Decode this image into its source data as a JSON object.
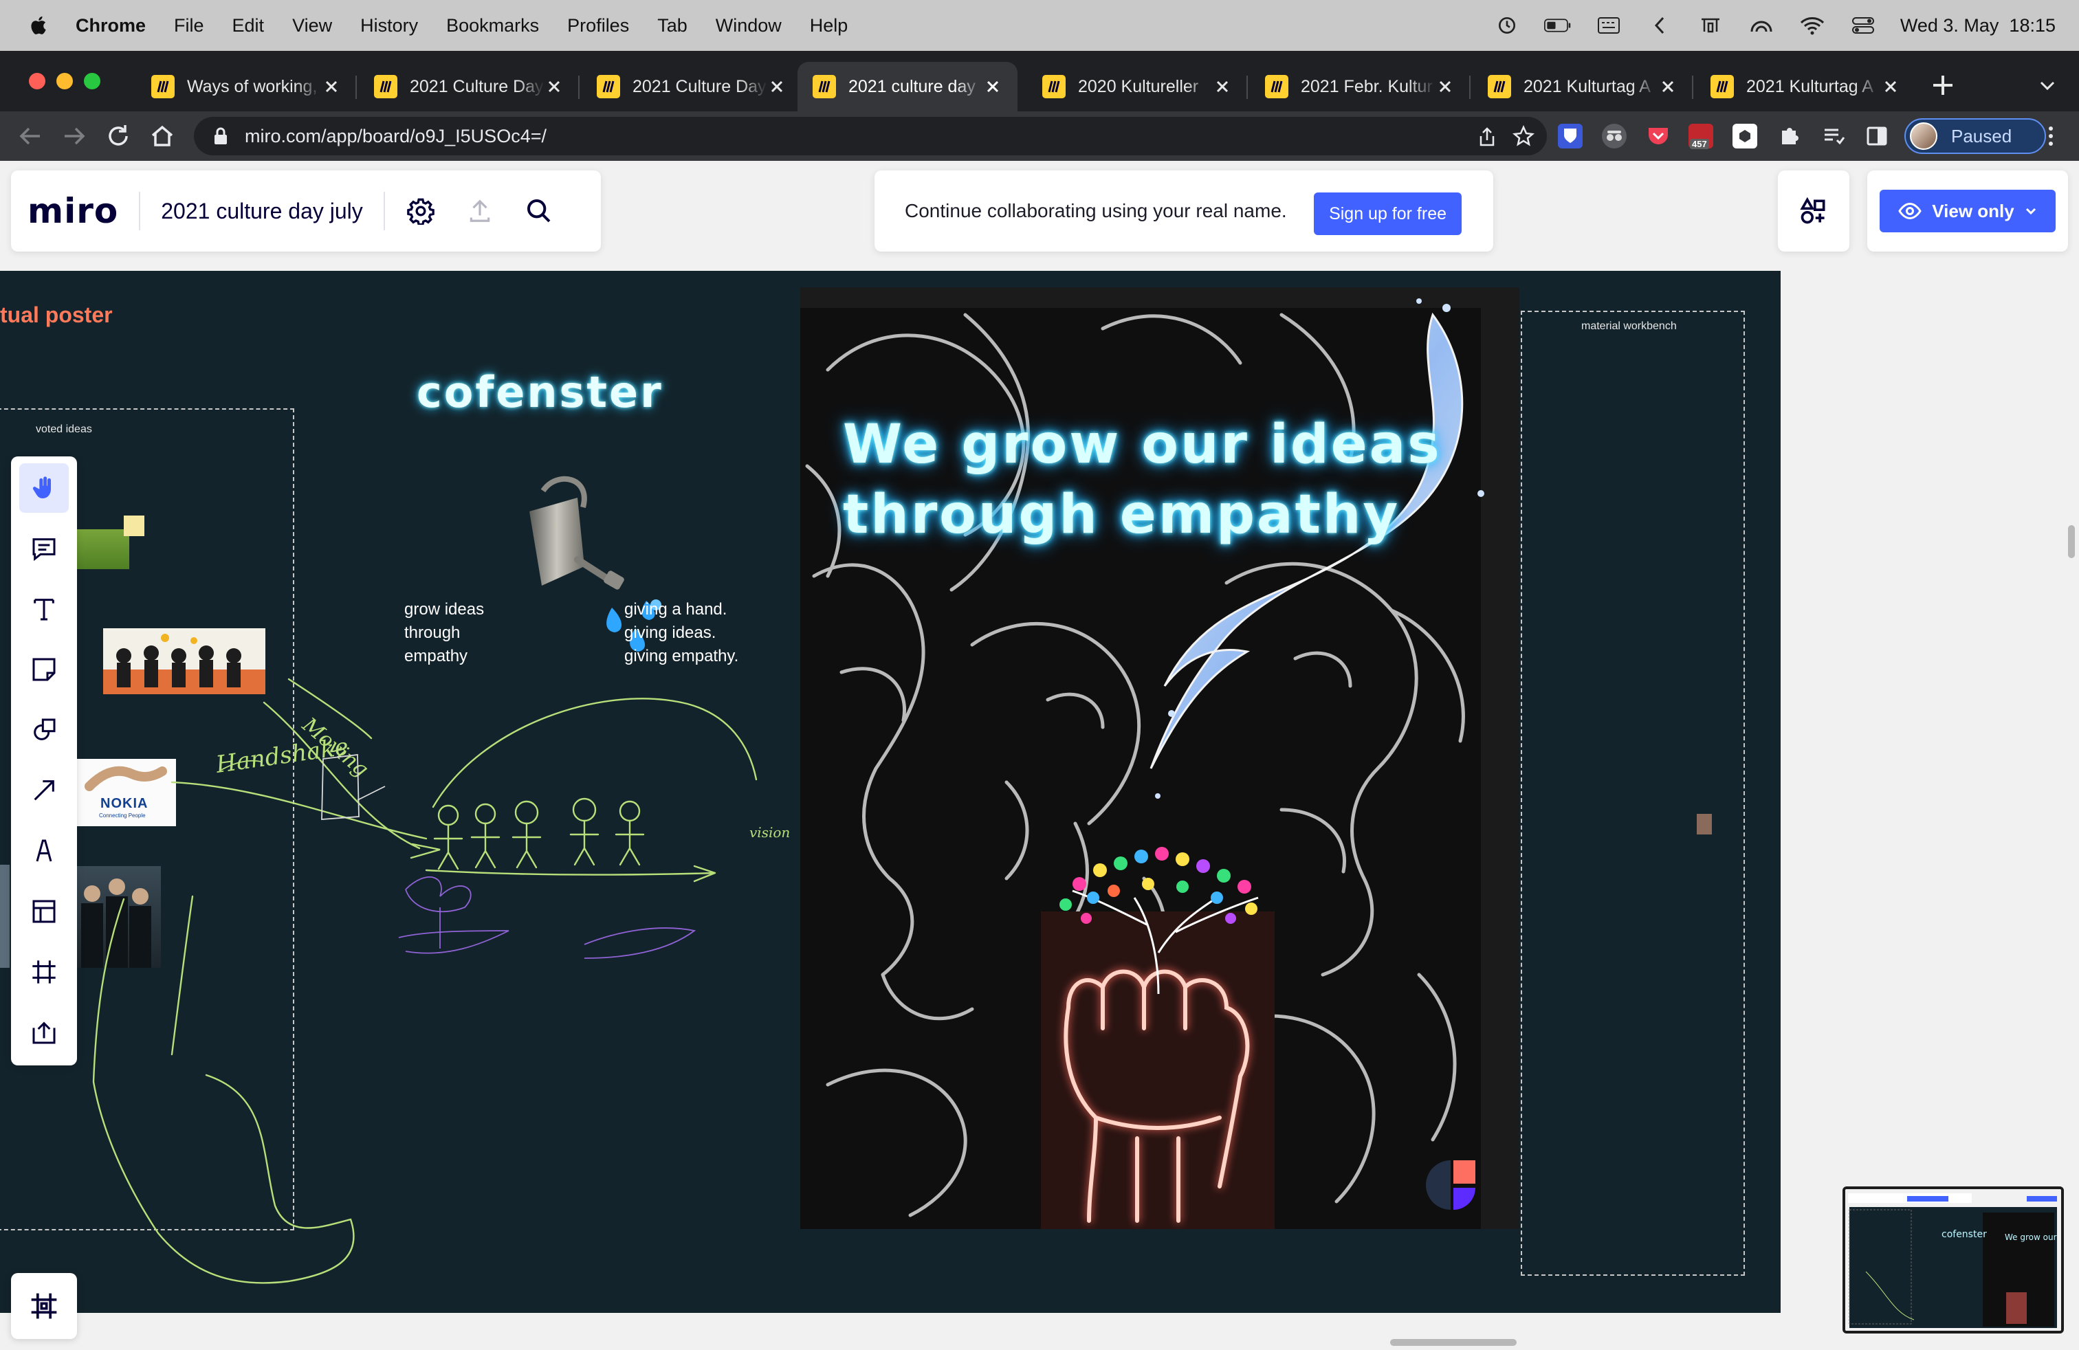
{
  "menubar": {
    "app": "Chrome",
    "items": [
      "File",
      "Edit",
      "View",
      "History",
      "Bookmarks",
      "Profiles",
      "Tab",
      "Window",
      "Help"
    ],
    "clock": "Wed 3. May  18:15"
  },
  "tabs": [
    {
      "title": "Ways of working,",
      "active": false
    },
    {
      "title": "2021 Culture Day",
      "active": false
    },
    {
      "title": "2021 Culture Day",
      "active": false
    },
    {
      "title": "2021 culture day",
      "active": true
    },
    {
      "title": "2020 Kultureller",
      "active": false
    },
    {
      "title": "2021 Febr. Kultur",
      "active": false
    },
    {
      "title": "2021 Kulturtag A",
      "active": false
    },
    {
      "title": "2021 Kulturtag A",
      "active": false
    }
  ],
  "toolbar": {
    "url": "miro.com/app/board/o9J_I5USOc4=/",
    "profile_label": "Paused",
    "ext_badge": "457"
  },
  "miro": {
    "logo": "miro",
    "board_title": "2021 culture day july",
    "banner_text": "Continue collaborating using your real name.",
    "signup_label": "Sign up for free",
    "view_label": "View only"
  },
  "board": {
    "frame_title": "tual poster",
    "voted_label": "voted ideas",
    "workbench_label": "material workbench",
    "note_left": "grow ideas\nthrough\nempathy",
    "note_right": "giving a hand.\ngiving ideas.\ngiving empathy.",
    "cofenster": "cofenster",
    "nokia": "NOKIA",
    "nokia_tagline": "Connecting People",
    "sketch_words": [
      "Handshake",
      "Moving",
      "vision"
    ]
  },
  "poster": {
    "title": "We grow our ideas through empathy"
  },
  "colors": {
    "accent": "#4262ff",
    "board_bg": "#13232b",
    "frame_title": "#ff7a5a",
    "sketch_green": "#b8e07a"
  }
}
